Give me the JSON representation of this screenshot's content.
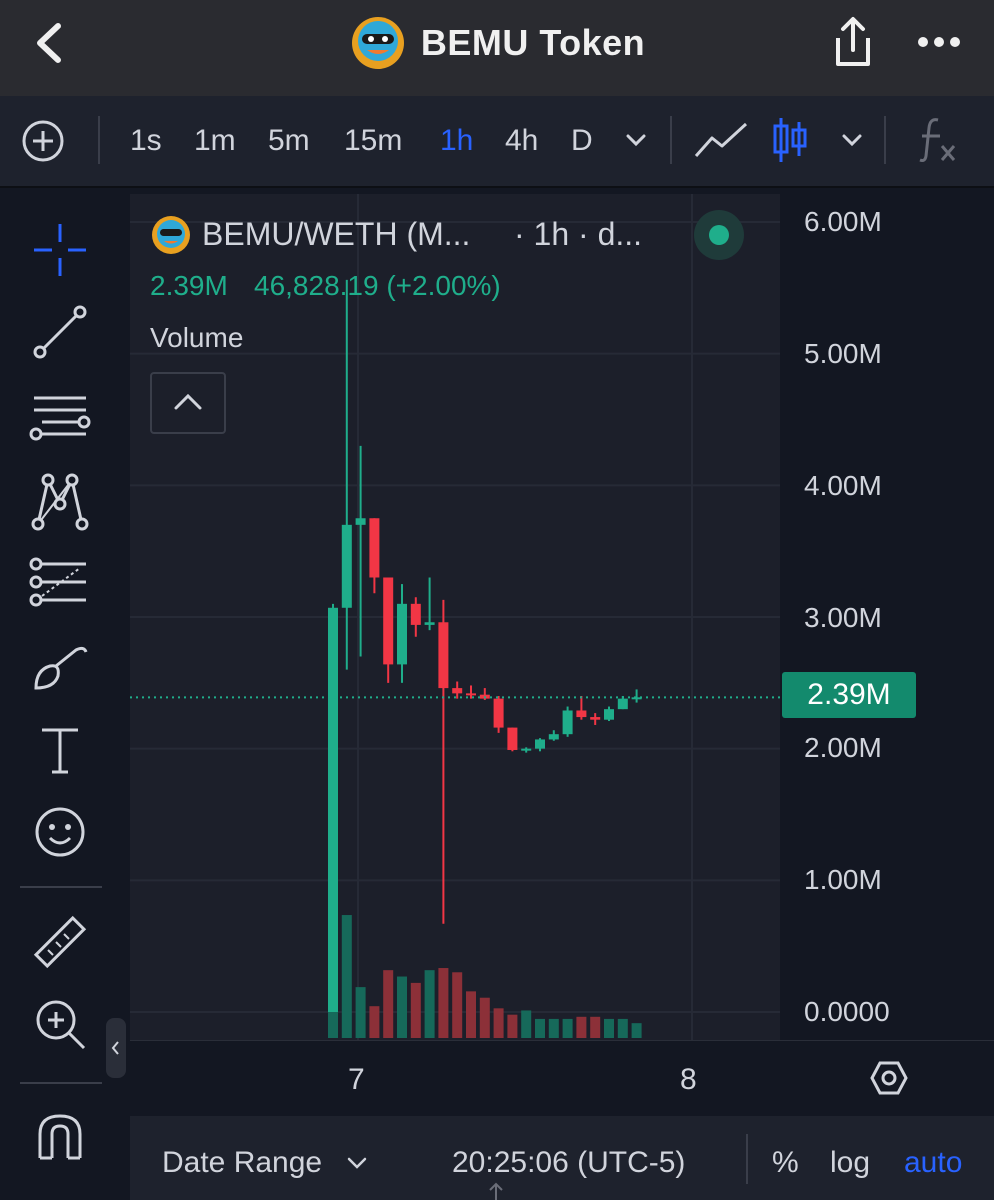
{
  "header": {
    "title": "BEMU Token",
    "back_icon": "chevron-left-icon",
    "share_icon": "share-icon",
    "more_icon": "more-dots-icon"
  },
  "toolbar": {
    "intervals": [
      "1s",
      "1m",
      "5m",
      "15m",
      "1h",
      "4h",
      "D"
    ],
    "active_interval": "1h",
    "accent_color": "#2962ff"
  },
  "legend": {
    "pair": "BEMU/WETH (M...",
    "meta": "· 1h · d...",
    "price": "2.39M",
    "change": "46,828.19 (+2.00%)",
    "volume_label": "Volume",
    "status_color": "#1fae8b"
  },
  "price_axis": {
    "labels": [
      "6.00M",
      "5.00M",
      "4.00M",
      "3.00M",
      "2.00M",
      "1.00M",
      "0.0000"
    ],
    "current": "2.39M"
  },
  "time_axis": {
    "labels": [
      "7",
      "8"
    ]
  },
  "bottom": {
    "date_range": "Date Range",
    "time": "20:25:06 (UTC-5)",
    "percent": "%",
    "log": "log",
    "auto": "auto"
  },
  "chart_data": {
    "type": "candlestick",
    "title": "BEMU/WETH",
    "ylim": [
      0,
      6000000
    ],
    "x_ticks": [
      "7",
      "8"
    ],
    "candles": [
      {
        "open": 0,
        "high": 3100000,
        "low": 0,
        "close": 3070000,
        "dir": "up"
      },
      {
        "open": 3070000,
        "high": 5560000,
        "low": 2600000,
        "close": 3700000,
        "dir": "up"
      },
      {
        "open": 3700000,
        "high": 4300000,
        "low": 2700000,
        "close": 3750000,
        "dir": "up"
      },
      {
        "open": 3750000,
        "high": 3750000,
        "low": 3180000,
        "close": 3300000,
        "dir": "down"
      },
      {
        "open": 3300000,
        "high": 3300000,
        "low": 2500000,
        "close": 2640000,
        "dir": "down"
      },
      {
        "open": 2640000,
        "high": 3250000,
        "low": 2500000,
        "close": 3100000,
        "dir": "up"
      },
      {
        "open": 3100000,
        "high": 3150000,
        "low": 2850000,
        "close": 2940000,
        "dir": "down"
      },
      {
        "open": 2940000,
        "high": 3300000,
        "low": 2900000,
        "close": 2960000,
        "dir": "up"
      },
      {
        "open": 2960000,
        "high": 3130000,
        "low": 670000,
        "close": 2460000,
        "dir": "down"
      },
      {
        "open": 2460000,
        "high": 2510000,
        "low": 2380000,
        "close": 2420000,
        "dir": "down"
      },
      {
        "open": 2420000,
        "high": 2480000,
        "low": 2380000,
        "close": 2410000,
        "dir": "down"
      },
      {
        "open": 2410000,
        "high": 2460000,
        "low": 2370000,
        "close": 2380000,
        "dir": "down"
      },
      {
        "open": 2380000,
        "high": 2400000,
        "low": 2120000,
        "close": 2160000,
        "dir": "down"
      },
      {
        "open": 2160000,
        "high": 2160000,
        "low": 1980000,
        "close": 1990000,
        "dir": "down"
      },
      {
        "open": 1990000,
        "high": 2010000,
        "low": 1970000,
        "close": 2000000,
        "dir": "up"
      },
      {
        "open": 2000000,
        "high": 2080000,
        "low": 1980000,
        "close": 2070000,
        "dir": "up"
      },
      {
        "open": 2070000,
        "high": 2140000,
        "low": 2060000,
        "close": 2110000,
        "dir": "up"
      },
      {
        "open": 2110000,
        "high": 2320000,
        "low": 2090000,
        "close": 2290000,
        "dir": "up"
      },
      {
        "open": 2290000,
        "high": 2400000,
        "low": 2220000,
        "close": 2240000,
        "dir": "down"
      },
      {
        "open": 2240000,
        "high": 2270000,
        "low": 2180000,
        "close": 2220000,
        "dir": "down"
      },
      {
        "open": 2220000,
        "high": 2320000,
        "low": 2210000,
        "close": 2300000,
        "dir": "up"
      },
      {
        "open": 2300000,
        "high": 2400000,
        "low": 2300000,
        "close": 2380000,
        "dir": "up"
      },
      {
        "open": 2380000,
        "high": 2450000,
        "low": 2350000,
        "close": 2390000,
        "dir": "up"
      }
    ],
    "volume_relative": [
      1.0,
      0.58,
      0.24,
      0.15,
      0.32,
      0.29,
      0.26,
      0.32,
      0.33,
      0.31,
      0.22,
      0.19,
      0.14,
      0.11,
      0.13,
      0.09,
      0.09,
      0.09,
      0.1,
      0.1,
      0.09,
      0.09,
      0.07
    ]
  }
}
